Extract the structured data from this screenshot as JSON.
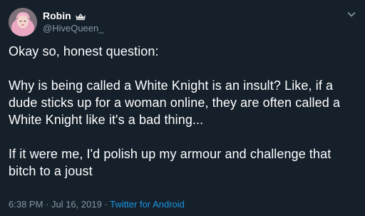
{
  "author": {
    "display_name": "Robin",
    "handle": "@HiveQueen_",
    "badge_icon": "crown-icon",
    "avatar_icon": "avatar-photo"
  },
  "tweet": {
    "paragraphs": [
      "Okay so, honest question:",
      "Why is being called a White Knight is an insult? Like, if a dude sticks up for a woman online, they are often called a White Knight like it's a bad thing...",
      "If it were me, I'd polish up my armour and challenge that bitch to a joust"
    ],
    "timestamp": "6:38 PM · Jul 16, 2019",
    "separator": " · ",
    "source": "Twitter for Android"
  },
  "colors": {
    "background": "#15202b",
    "text_primary": "#ffffff",
    "text_secondary": "#8899a6",
    "link": "#1b95e0"
  },
  "icons": {
    "menu": "chevron-down-icon"
  }
}
